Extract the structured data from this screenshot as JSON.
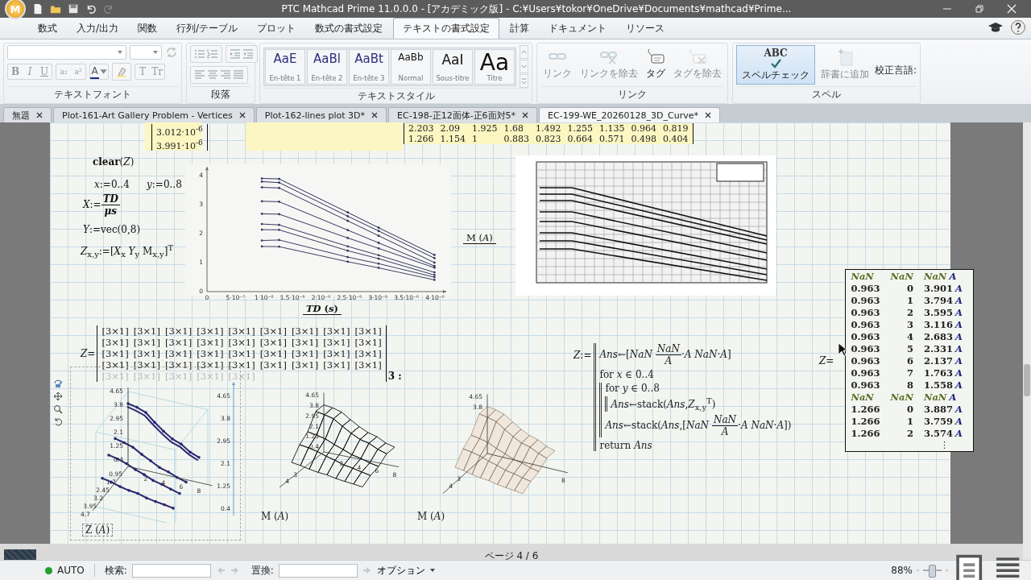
{
  "window": {
    "logo": "M",
    "title": "PTC Mathcad Prime 11.0.0.0 - [アカデミック版] - C:¥Users¥tokor¥OneDrive¥Documents¥mathcad¥Prime..."
  },
  "ribbon_tabs": [
    {
      "label": "数式",
      "selected": false
    },
    {
      "label": "入力/出力",
      "selected": false
    },
    {
      "label": "関数",
      "selected": false
    },
    {
      "label": "行列/テーブル",
      "selected": false
    },
    {
      "label": "プロット",
      "selected": false
    },
    {
      "label": "数式の書式設定",
      "selected": false
    },
    {
      "label": "テキストの書式設定",
      "selected": true
    },
    {
      "label": "計算",
      "selected": false
    },
    {
      "label": "ドキュメント",
      "selected": false
    },
    {
      "label": "リソース",
      "selected": false
    }
  ],
  "ribbon": {
    "text_font": {
      "label": "テキストフォント",
      "format_buttons": [
        "B",
        "I",
        "U"
      ],
      "script_buttons": [
        "a₂",
        "a²"
      ],
      "color_button": "A",
      "case_buttons": [
        "T",
        "Tr"
      ]
    },
    "paragraph": {
      "label": "段落"
    },
    "text_styles": {
      "label": "テキストスタイル",
      "styles": [
        {
          "preview": "AaE",
          "name": "En-tête 1",
          "kind": "heading"
        },
        {
          "preview": "AaBl",
          "name": "En-tête 2",
          "kind": "heading"
        },
        {
          "preview": "AaBt",
          "name": "En-tête 3",
          "kind": "heading"
        },
        {
          "preview": "AaBb",
          "name": "Normal",
          "kind": "normal"
        },
        {
          "preview": "AaI",
          "name": "Sous-titre",
          "kind": "subtitle"
        },
        {
          "preview": "Aa",
          "name": "Titre",
          "kind": "title"
        }
      ]
    },
    "links": {
      "label": "リンク",
      "buttons": [
        {
          "label": "リンク",
          "kind": "link",
          "disabled": true
        },
        {
          "label": "リンクを除去",
          "kind": "unlink",
          "disabled": true
        },
        {
          "label": "タグ",
          "kind": "tag",
          "disabled": false
        },
        {
          "label": "タグを除去",
          "kind": "untag",
          "disabled": true
        }
      ]
    },
    "spell": {
      "label": "スペル",
      "check": {
        "badge": "ABC",
        "label": "スペルチェック",
        "selected": true
      },
      "add": {
        "label": "辞書に追加",
        "disabled": true
      },
      "language_label": "校正言語:"
    }
  },
  "doc_tabs": [
    {
      "label": "無題",
      "selected": false
    },
    {
      "label": "Plot-161-Art Gallery Problem - Vertices",
      "selected": false
    },
    {
      "label": "Plot-162-lines plot 3D*",
      "selected": false
    },
    {
      "label": "EC-198-正12面体-正6面対5*",
      "selected": false
    },
    {
      "label": "EC-199-WE_20260128_3D_Curve*",
      "selected": true
    }
  ],
  "worksheet": {
    "top_vector": [
      "3.012·10$^{-6}$",
      "3.991·10$^{-6}$"
    ],
    "top_matrix": [
      [
        "2.203",
        "2.09",
        "1.925",
        "1.68",
        "1.492",
        "1.255",
        "1.135",
        "0.964",
        "0.819"
      ],
      [
        "1.266",
        "1.154",
        "1",
        "0.883",
        "0.823",
        "0.664",
        "0.571",
        "0.498",
        "0.404"
      ]
    ],
    "clear": [
      "**clear**(*Z*)"
    ],
    "range_x": [
      "*x*:=0..4"
    ],
    "range_y": [
      "*y*:=0..8"
    ],
    "def_X": [
      "*X*:=",
      {
        "num": "*TD*",
        "den": "*μs*"
      }
    ],
    "def_Y": [
      "*Y*:=vec(0,8)"
    ],
    "def_Z": [
      "*Z*$_{x,y}$:=[*X*$_{x}$ *Y*$_{y}$ M$_{x,y}$]$^{T}$"
    ],
    "plot_2d": {
      "chart_data": {
        "type": "line",
        "xlabel": "*TD* (*s*)",
        "ylabel": "M (*A*)",
        "x": [
          9.63e-07,
          1.266e-06,
          2.47e-06,
          3.012e-06,
          3.991e-06
        ],
        "xlim": [
          0,
          4.2e-06
        ],
        "ylim": [
          0,
          4.3
        ],
        "xticks": [
          0,
          {
            "value": 5e-07,
            "label": "5·10⁻⁷"
          },
          {
            "value": 1e-06,
            "label": "1·10⁻⁶"
          },
          {
            "value": 1.5e-06,
            "label": "1.5·10⁻⁶"
          },
          {
            "value": 2e-06,
            "label": "2·10⁻⁶"
          },
          {
            "value": 2.5e-06,
            "label": "2.5·10⁻⁶"
          },
          {
            "value": 3e-06,
            "label": "3·10⁻⁶"
          },
          {
            "value": 3.5e-06,
            "label": "3.5·10⁻⁶"
          },
          {
            "value": 4e-06,
            "label": "4·10⁻⁶"
          }
        ],
        "yticks": [
          0,
          1,
          2,
          3,
          4
        ],
        "series": [
          {
            "color": "#2e2e5e",
            "values": [
              3.901,
              3.887,
              2.73,
              2.203,
              1.266
            ]
          },
          {
            "color": "#30305f",
            "values": [
              3.794,
              3.759,
              2.6,
              2.09,
              1.154
            ]
          },
          {
            "color": "#323260",
            "values": [
              3.595,
              3.574,
              2.44,
              1.925,
              1
            ]
          },
          {
            "color": "#343461",
            "values": [
              3.116,
              3.1,
              2.12,
              1.68,
              0.883
            ]
          },
          {
            "color": "#363662",
            "values": [
              2.683,
              2.67,
              1.85,
              1.492,
              0.823
            ]
          },
          {
            "color": "#383863",
            "values": [
              2.331,
              2.3,
              1.56,
              1.255,
              0.664
            ]
          },
          {
            "color": "#3a3a64",
            "values": [
              2.137,
              2.13,
              1.41,
              1.135,
              0.571
            ]
          },
          {
            "color": "#3c3c65",
            "values": [
              1.763,
              1.78,
              1.19,
              0.964,
              0.498
            ]
          },
          {
            "color": "#3e3e66",
            "values": [
              1.558,
              1.55,
              1.03,
              0.819,
              0.404
            ]
          }
        ]
      }
    },
    "image": {
      "kind": "picture"
    },
    "z_matrix": {
      "label": "*Z*=",
      "rows": [
        {
          "faded": false,
          "cells": [
            "[3×1]",
            "[3×1]",
            "[3×1]",
            "[3×1]",
            "[3×1]",
            "[3×1]",
            "[3×1]",
            "[3×1]",
            "[3×1]"
          ]
        },
        {
          "faded": false,
          "cells": [
            "[3×1]",
            "[3×1]",
            "[3×1]",
            "[3×1]",
            "[3×1]",
            "[3×1]",
            "[3×1]",
            "[3×1]",
            "[3×1]"
          ]
        },
        {
          "faded": false,
          "cells": [
            "[3×1]",
            "[3×1]",
            "[3×1]",
            "[3×1]",
            "[3×1]",
            "[3×1]",
            "[3×1]",
            "[3×1]",
            "[3×1]"
          ]
        },
        {
          "faded": false,
          "cells": [
            "[3×1]",
            "[3×1]",
            "[3×1]",
            "[3×1]",
            "[3×1]",
            "[3×1]",
            "[3×1]",
            "[3×1]",
            "[3×1]"
          ]
        },
        {
          "faded": true,
          "cells": [
            "[3×1]",
            "[3×1]",
            "[3×1]",
            "[3×1]",
            "[3×1]"
          ]
        }
      ],
      "fragment": "3 :"
    },
    "plots_3d": [
      {
        "kind": "lines",
        "label": "Z (*A*)",
        "z_ticks": [
          "4.65",
          "3.8",
          "2.95",
          "2.1",
          "1.25",
          "0.4"
        ],
        "x_ticks": [
          "2",
          "4",
          "6",
          "8"
        ],
        "y_ticks": [
          "0.95",
          "1.7",
          "2.45",
          "3.2",
          "3.95",
          "4.7"
        ],
        "scale_ticks": [
          "4.65",
          "3.8",
          "2.95",
          "2.1",
          "1.25",
          "0.4"
        ]
      },
      {
        "kind": "wireframe",
        "label": "M (*A*)",
        "z_ticks": [
          "4.65",
          "3.8",
          "2.95",
          "2.1",
          "1.25",
          "0.4"
        ],
        "x_ticks": [
          "2",
          "4",
          "6",
          "8"
        ],
        "y_ticks": [
          "3",
          "4"
        ]
      },
      {
        "kind": "surface",
        "label": "M (*A*)",
        "z_ticks": [
          "4.65",
          "3.8"
        ],
        "x_ticks": [
          "8"
        ],
        "y_ticks": [
          "3",
          "4"
        ]
      }
    ],
    "program": {
      "label": "*Z*:=",
      "lines": [
        {
          "parts": [
            "*Ans*←[*NaN* ",
            {
              "num": "*NaN*",
              "den": "*A*"
            },
            "·*A* *NaN*·*A*]"
          ]
        },
        {
          "parts": [
            "for *x* ∈ 0..4"
          ],
          "children": [
            {
              "parts": [
                "for *y* ∈ 0..8"
              ],
              "children": [
                {
                  "parts": [
                    "*Ans*←stack(*Ans*,*Z*$_{x,y}$$^{T}$)"
                  ]
                }
              ]
            },
            {
              "parts": [
                "*Ans*←stack(*Ans*,[*NaN* ",
                {
                  "num": "*NaN*",
                  "den": "*A*"
                },
                "·*A* *NaN*·*A*])"
              ]
            }
          ]
        },
        {
          "parts": [
            "return *Ans*"
          ]
        }
      ]
    },
    "result": {
      "label": "*Z*=",
      "more": "⋮",
      "rows": [
        {
          "kind": "nan",
          "cells": [
            "NaN",
            "NaN",
            "NaN"
          ],
          "unit": "A"
        },
        {
          "kind": "value",
          "cells": [
            "0.963",
            "0",
            "3.901"
          ],
          "unit": "A"
        },
        {
          "kind": "value",
          "cells": [
            "0.963",
            "1",
            "3.794"
          ],
          "unit": "A"
        },
        {
          "kind": "value",
          "cells": [
            "0.963",
            "2",
            "3.595"
          ],
          "unit": "A"
        },
        {
          "kind": "value",
          "cells": [
            "0.963",
            "3",
            "3.116"
          ],
          "unit": "A"
        },
        {
          "kind": "value",
          "cells": [
            "0.963",
            "4",
            "2.683"
          ],
          "unit": "A"
        },
        {
          "kind": "value",
          "cells": [
            "0.963",
            "5",
            "2.331"
          ],
          "unit": "A"
        },
        {
          "kind": "value",
          "cells": [
            "0.963",
            "6",
            "2.137"
          ],
          "unit": "A"
        },
        {
          "kind": "value",
          "cells": [
            "0.963",
            "7",
            "1.763"
          ],
          "unit": "A"
        },
        {
          "kind": "value",
          "cells": [
            "0.963",
            "8",
            "1.558"
          ],
          "unit": "A"
        },
        {
          "kind": "nan",
          "cells": [
            "NaN",
            "NaN",
            "NaN"
          ],
          "unit": "A"
        },
        {
          "kind": "value",
          "cells": [
            "1.266",
            "0",
            "3.887"
          ],
          "unit": "A"
        },
        {
          "kind": "value",
          "cells": [
            "1.266",
            "1",
            "3.759"
          ],
          "unit": "A"
        },
        {
          "kind": "value",
          "cells": [
            "1.266",
            "2",
            "3.574"
          ],
          "unit": "A"
        }
      ]
    },
    "page_label": "ページ 4 / 6"
  },
  "status_bar": {
    "mode": "AUTO",
    "find_label": "検索:",
    "replace_label": "置換:",
    "options": "オプション",
    "zoom": "88%",
    "zoom_slider": {
      "level": 0.47
    }
  }
}
